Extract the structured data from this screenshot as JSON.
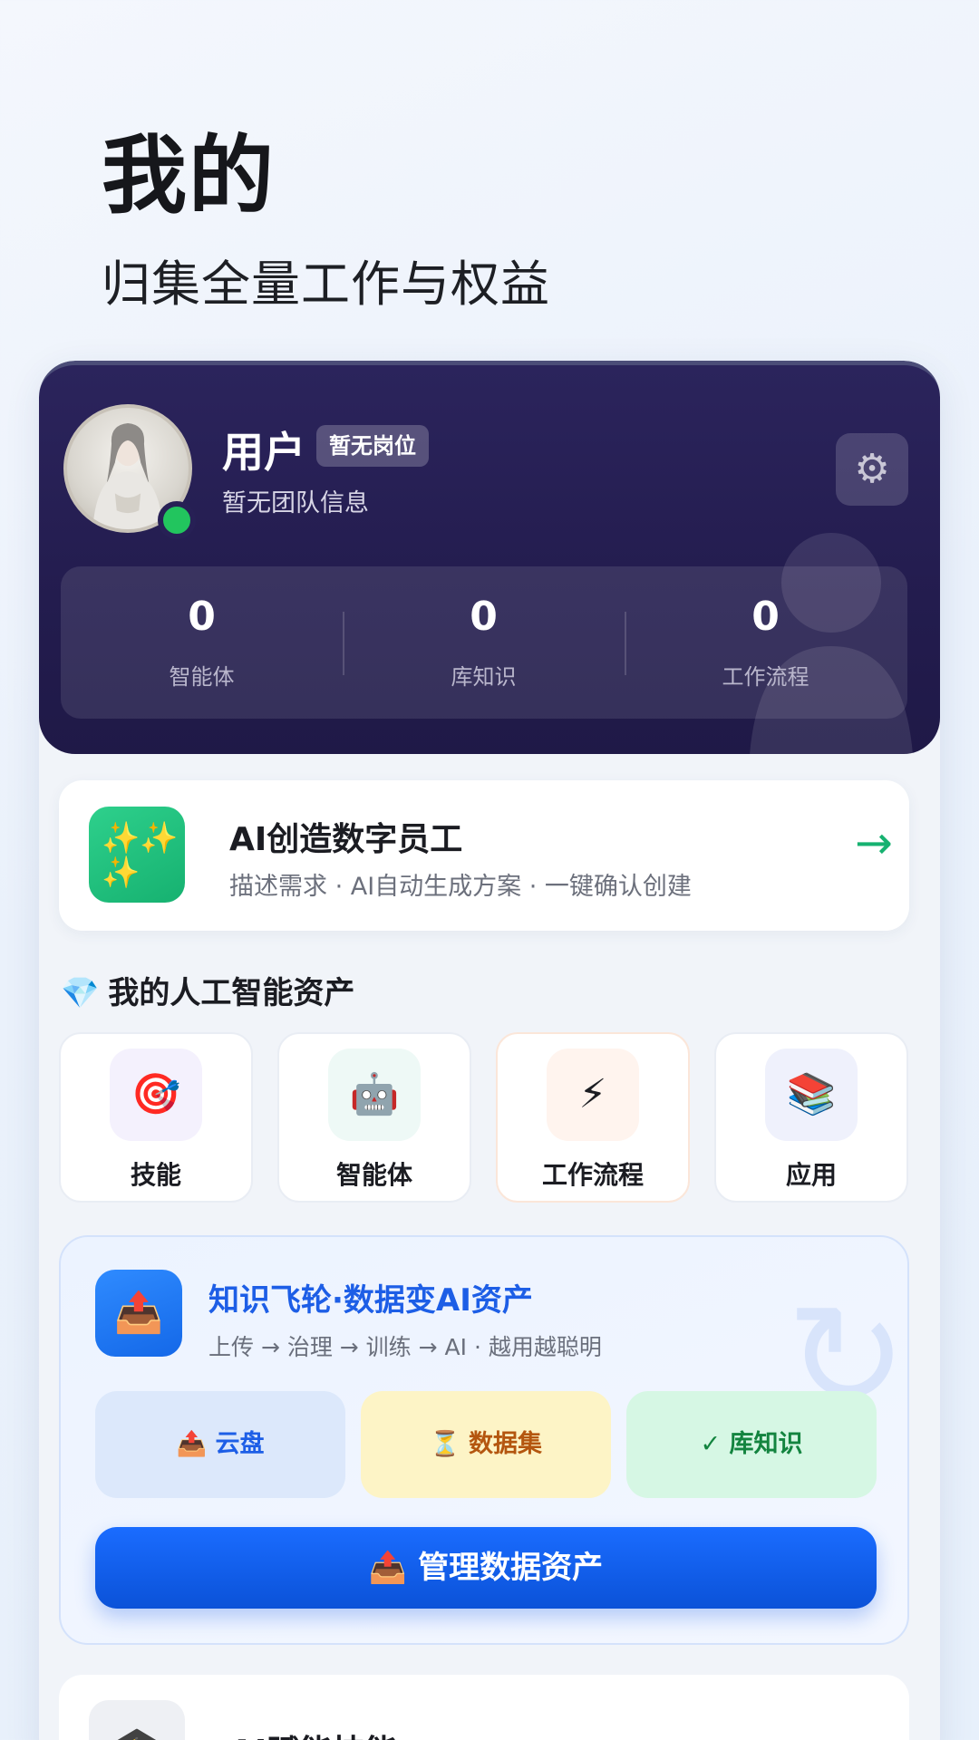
{
  "header": {
    "title": "我的",
    "subtitle": "归集全量工作与权益"
  },
  "profile": {
    "name": "用户",
    "role_badge": "暂无岗位",
    "team_info": "暂无团队信息",
    "stats": [
      {
        "value": "0",
        "label": "智能体"
      },
      {
        "value": "0",
        "label": "库知识"
      },
      {
        "value": "0",
        "label": "工作流程"
      }
    ]
  },
  "create_card": {
    "title": "AI创造数字员工",
    "description": "描述需求 · AI自动生成方案 · 一键确认创建",
    "icon": "sparkles-icon",
    "arrow": "→"
  },
  "assets": {
    "heading": "我的人工智能资产",
    "heading_icon": "💎",
    "tiles": [
      {
        "label": "技能",
        "icon": "🎯",
        "icon_name": "target-icon",
        "bg": "#f4f1fd"
      },
      {
        "label": "智能体",
        "icon": "🤖",
        "icon_name": "robot-icon",
        "bg": "#eef9f6"
      },
      {
        "label": "工作流程",
        "icon": "⚡",
        "icon_name": "lightning-icon",
        "bg": "#fff4ee"
      },
      {
        "label": "应用",
        "icon": "📚",
        "icon_name": "books-icon",
        "bg": "#eff1fc"
      }
    ]
  },
  "flywheel": {
    "title": "知识飞轮·数据变AI资产",
    "description": "上传 → 治理 → 训练 → AI · 越用越聪明",
    "icon": "📤",
    "chips": [
      {
        "icon": "📤",
        "label": "云盘",
        "bg": "#dce8fb",
        "color": "#1d5ee6"
      },
      {
        "icon": "⏳",
        "label": "数据集",
        "bg": "#fdf4c6",
        "color": "#b4560f"
      },
      {
        "icon": "✓",
        "label": "库知识",
        "bg": "#d6f7e4",
        "color": "#13843f"
      }
    ],
    "button_icon": "📤",
    "button_label": "管理数据资产"
  },
  "next_card": {
    "title": "AI赋能技能",
    "icon": "🎓"
  },
  "colors": {
    "profile_bg": "#231c4e",
    "accent_green": "#16b170",
    "accent_blue": "#1a6cff",
    "online": "#22c55e"
  }
}
